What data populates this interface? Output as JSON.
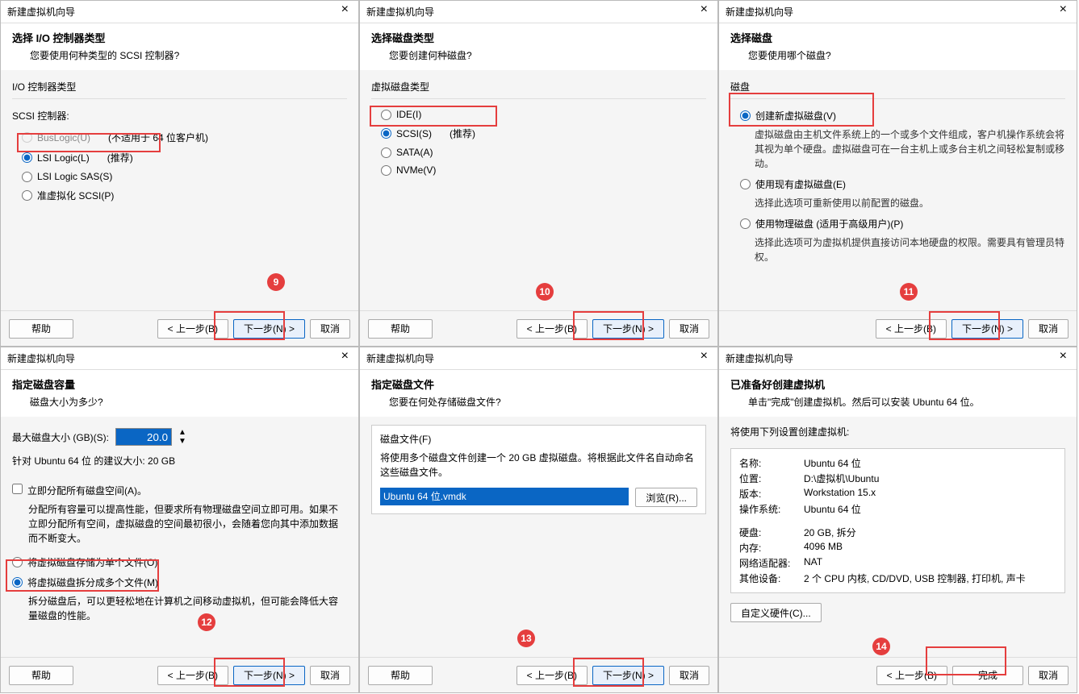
{
  "panes": {
    "p9": {
      "winTitle": "新建虚拟机向导",
      "title": "选择 I/O 控制器类型",
      "subtitle": "您要使用何种类型的 SCSI 控制器?",
      "group": "I/O 控制器类型",
      "scsiLabel": "SCSI 控制器:",
      "opts": {
        "buslogic": "BusLogic(U)",
        "buslogicNote": "(不适用于 64 位客户机)",
        "lsilogic": "LSI Logic(L)",
        "lsilogicNote": "(推荐)",
        "lsisas": "LSI Logic SAS(S)",
        "pvscsi": "准虚拟化 SCSI(P)"
      },
      "help": "帮助",
      "back": "< 上一步(B)",
      "next": "下一步(N) >",
      "cancel": "取消",
      "badge": "9"
    },
    "p10": {
      "winTitle": "新建虚拟机向导",
      "title": "选择磁盘类型",
      "subtitle": "您要创建何种磁盘?",
      "group": "虚拟磁盘类型",
      "opts": {
        "ide": "IDE(I)",
        "scsi": "SCSI(S)",
        "scsiNote": "(推荐)",
        "sata": "SATA(A)",
        "nvme": "NVMe(V)"
      },
      "help": "帮助",
      "back": "< 上一步(B)",
      "next": "下一步(N) >",
      "cancel": "取消",
      "badge": "10"
    },
    "p11": {
      "winTitle": "新建虚拟机向导",
      "title": "选择磁盘",
      "subtitle": "您要使用哪个磁盘?",
      "group": "磁盘",
      "opts": {
        "create": "创建新虚拟磁盘(V)",
        "createDesc": "虚拟磁盘由主机文件系统上的一个或多个文件组成，客户机操作系统会将其视为单个硬盘。虚拟磁盘可在一台主机上或多台主机之间轻松复制或移动。",
        "existing": "使用现有虚拟磁盘(E)",
        "existingDesc": "选择此选项可重新使用以前配置的磁盘。",
        "physical": "使用物理磁盘 (适用于高级用户)(P)",
        "physicalDesc": "选择此选项可为虚拟机提供直接访问本地硬盘的权限。需要具有管理员特权。"
      },
      "back": "< 上一步(B)",
      "next": "下一步(N) >",
      "cancel": "取消",
      "badge": "11"
    },
    "p12": {
      "winTitle": "新建虚拟机向导",
      "title": "指定磁盘容量",
      "subtitle": "磁盘大小为多少?",
      "sizeLabel": "最大磁盘大小 (GB)(S):",
      "sizeValue": "20.0",
      "recommend": "针对 Ubuntu 64 位 的建议大小: 20 GB",
      "allocNow": "立即分配所有磁盘空间(A)。",
      "allocDesc": "分配所有容量可以提高性能，但要求所有物理磁盘空间立即可用。如果不立即分配所有空间，虚拟磁盘的空间最初很小，会随着您向其中添加数据而不断变大。",
      "single": "将虚拟磁盘存储为单个文件(O)",
      "split": "将虚拟磁盘拆分成多个文件(M)",
      "splitDesc": "拆分磁盘后，可以更轻松地在计算机之间移动虚拟机，但可能会降低大容量磁盘的性能。",
      "help": "帮助",
      "back": "< 上一步(B)",
      "next": "下一步(N) >",
      "cancel": "取消",
      "badge": "12"
    },
    "p13": {
      "winTitle": "新建虚拟机向导",
      "title": "指定磁盘文件",
      "subtitle": "您要在何处存储磁盘文件?",
      "group": "磁盘文件(F)",
      "desc": "将使用多个磁盘文件创建一个 20 GB 虚拟磁盘。将根据此文件名自动命名这些磁盘文件。",
      "fileValue": "Ubuntu 64 位.vmdk",
      "browse": "浏览(R)...",
      "help": "帮助",
      "back": "< 上一步(B)",
      "next": "下一步(N) >",
      "cancel": "取消",
      "badge": "13"
    },
    "p14": {
      "winTitle": "新建虚拟机向导",
      "title": "已准备好创建虚拟机",
      "subtitle": "单击\"完成\"创建虚拟机。然后可以安装 Ubuntu 64 位。",
      "listHead": "将使用下列设置创建虚拟机:",
      "rows": {
        "name_k": "名称:",
        "name_v": "Ubuntu 64 位",
        "loc_k": "位置:",
        "loc_v": "D:\\虚拟机\\Ubuntu",
        "ver_k": "版本:",
        "ver_v": "Workstation 15.x",
        "os_k": "操作系统:",
        "os_v": "Ubuntu 64 位",
        "hd_k": "硬盘:",
        "hd_v": "20 GB, 拆分",
        "mem_k": "内存:",
        "mem_v": "4096 MB",
        "net_k": "网络适配器:",
        "net_v": "NAT",
        "other_k": "其他设备:",
        "other_v": "2 个 CPU 内核, CD/DVD, USB 控制器, 打印机, 声卡"
      },
      "custom": "自定义硬件(C)...",
      "back": "< 上一步(B)",
      "finish": "完成",
      "cancel": "取消",
      "badge": "14"
    }
  }
}
